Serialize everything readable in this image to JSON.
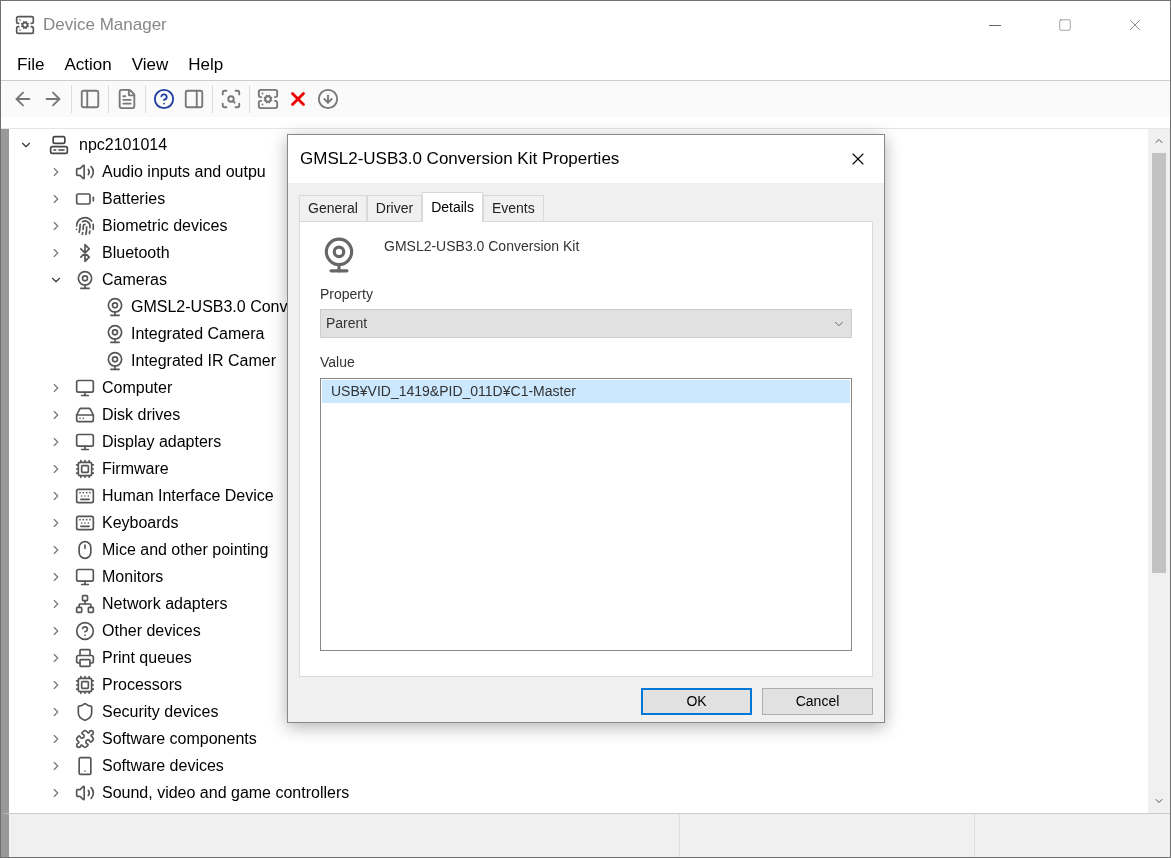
{
  "window": {
    "title": "Device Manager"
  },
  "menu": [
    "File",
    "Action",
    "View",
    "Help"
  ],
  "tree": {
    "label": "npc2101014",
    "expanded": true,
    "children": [
      {
        "label": "Audio inputs and outpu",
        "expanded": false
      },
      {
        "label": "Batteries",
        "expanded": false
      },
      {
        "label": "Biometric devices",
        "expanded": false
      },
      {
        "label": "Bluetooth",
        "expanded": false
      },
      {
        "label": "Cameras",
        "expanded": true,
        "children": [
          {
            "label": "GMSL2-USB3.0 Conv"
          },
          {
            "label": "Integrated Camera"
          },
          {
            "label": "Integrated IR Camer"
          }
        ]
      },
      {
        "label": "Computer",
        "expanded": false
      },
      {
        "label": "Disk drives",
        "expanded": false
      },
      {
        "label": "Display adapters",
        "expanded": false
      },
      {
        "label": "Firmware",
        "expanded": false
      },
      {
        "label": "Human Interface Device",
        "expanded": false
      },
      {
        "label": "Keyboards",
        "expanded": false
      },
      {
        "label": "Mice and other pointing",
        "expanded": false
      },
      {
        "label": "Monitors",
        "expanded": false
      },
      {
        "label": "Network adapters",
        "expanded": false
      },
      {
        "label": "Other devices",
        "expanded": false
      },
      {
        "label": "Print queues",
        "expanded": false
      },
      {
        "label": "Processors",
        "expanded": false
      },
      {
        "label": "Security devices",
        "expanded": false
      },
      {
        "label": "Software components",
        "expanded": false
      },
      {
        "label": "Software devices",
        "expanded": false
      },
      {
        "label": "Sound, video and game controllers",
        "expanded": false
      }
    ]
  },
  "dialog": {
    "title": "GMSL2-USB3.0 Conversion Kit Properties",
    "tabs": [
      {
        "label": "General",
        "selected": false
      },
      {
        "label": "Driver",
        "selected": false
      },
      {
        "label": "Details",
        "selected": true
      },
      {
        "label": "Events",
        "selected": false
      }
    ],
    "device_name": "GMSL2-USB3.0 Conversion Kit",
    "property_label": "Property",
    "property_value": "Parent",
    "value_label": "Value",
    "values": [
      {
        "text": "USB¥VID_1419&PID_011D¥C1-Master",
        "selected": true
      }
    ],
    "buttons": [
      {
        "label": "OK",
        "default": true
      },
      {
        "label": "Cancel",
        "default": false
      }
    ]
  }
}
